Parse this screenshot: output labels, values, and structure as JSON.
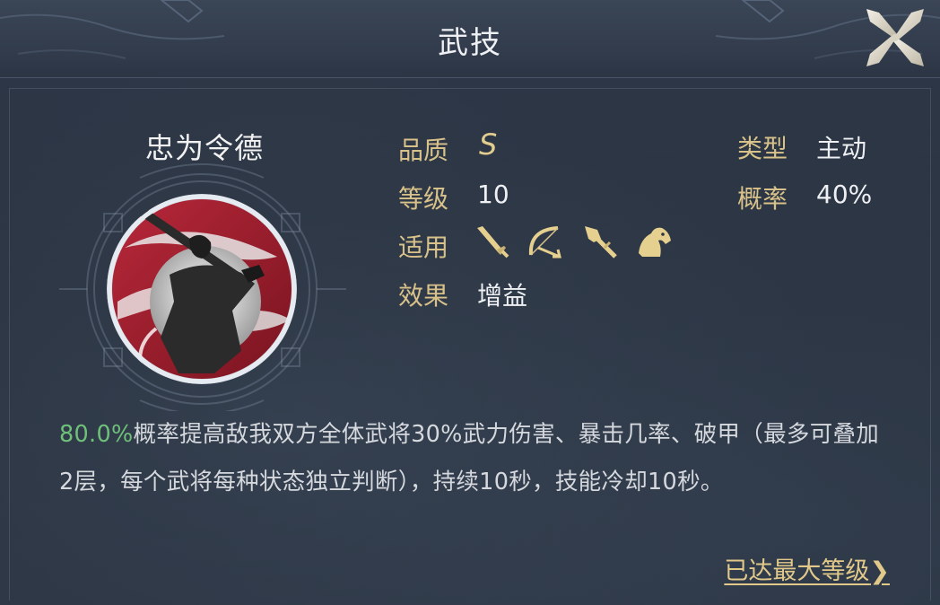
{
  "header": {
    "title": "武技"
  },
  "skill": {
    "name": "忠为令德",
    "quality_label": "品质",
    "quality_value": "S",
    "level_label": "等级",
    "level_value": "10",
    "applies_label": "适用",
    "applies_icons": [
      "sword-icon",
      "bow-icon",
      "spear-icon",
      "horse-icon"
    ],
    "effect_label": "效果",
    "effect_value": "增益",
    "type_label": "类型",
    "type_value": "主动",
    "rate_label": "概率",
    "rate_value": "40%"
  },
  "description": {
    "highlight": "80.0%",
    "text": "概率提高敌我双方全体武将30%武力伤害、暴击几率、破甲（最多可叠加2层，每个武将每种状态独立判断），持续10秒，技能冷却10秒。"
  },
  "footer": {
    "max_level_link": "已达最大等级",
    "chevron": "❯"
  },
  "colors": {
    "label_gold": "#d9c28a",
    "highlight_green": "#6fc07a",
    "background": "#2a3444"
  }
}
